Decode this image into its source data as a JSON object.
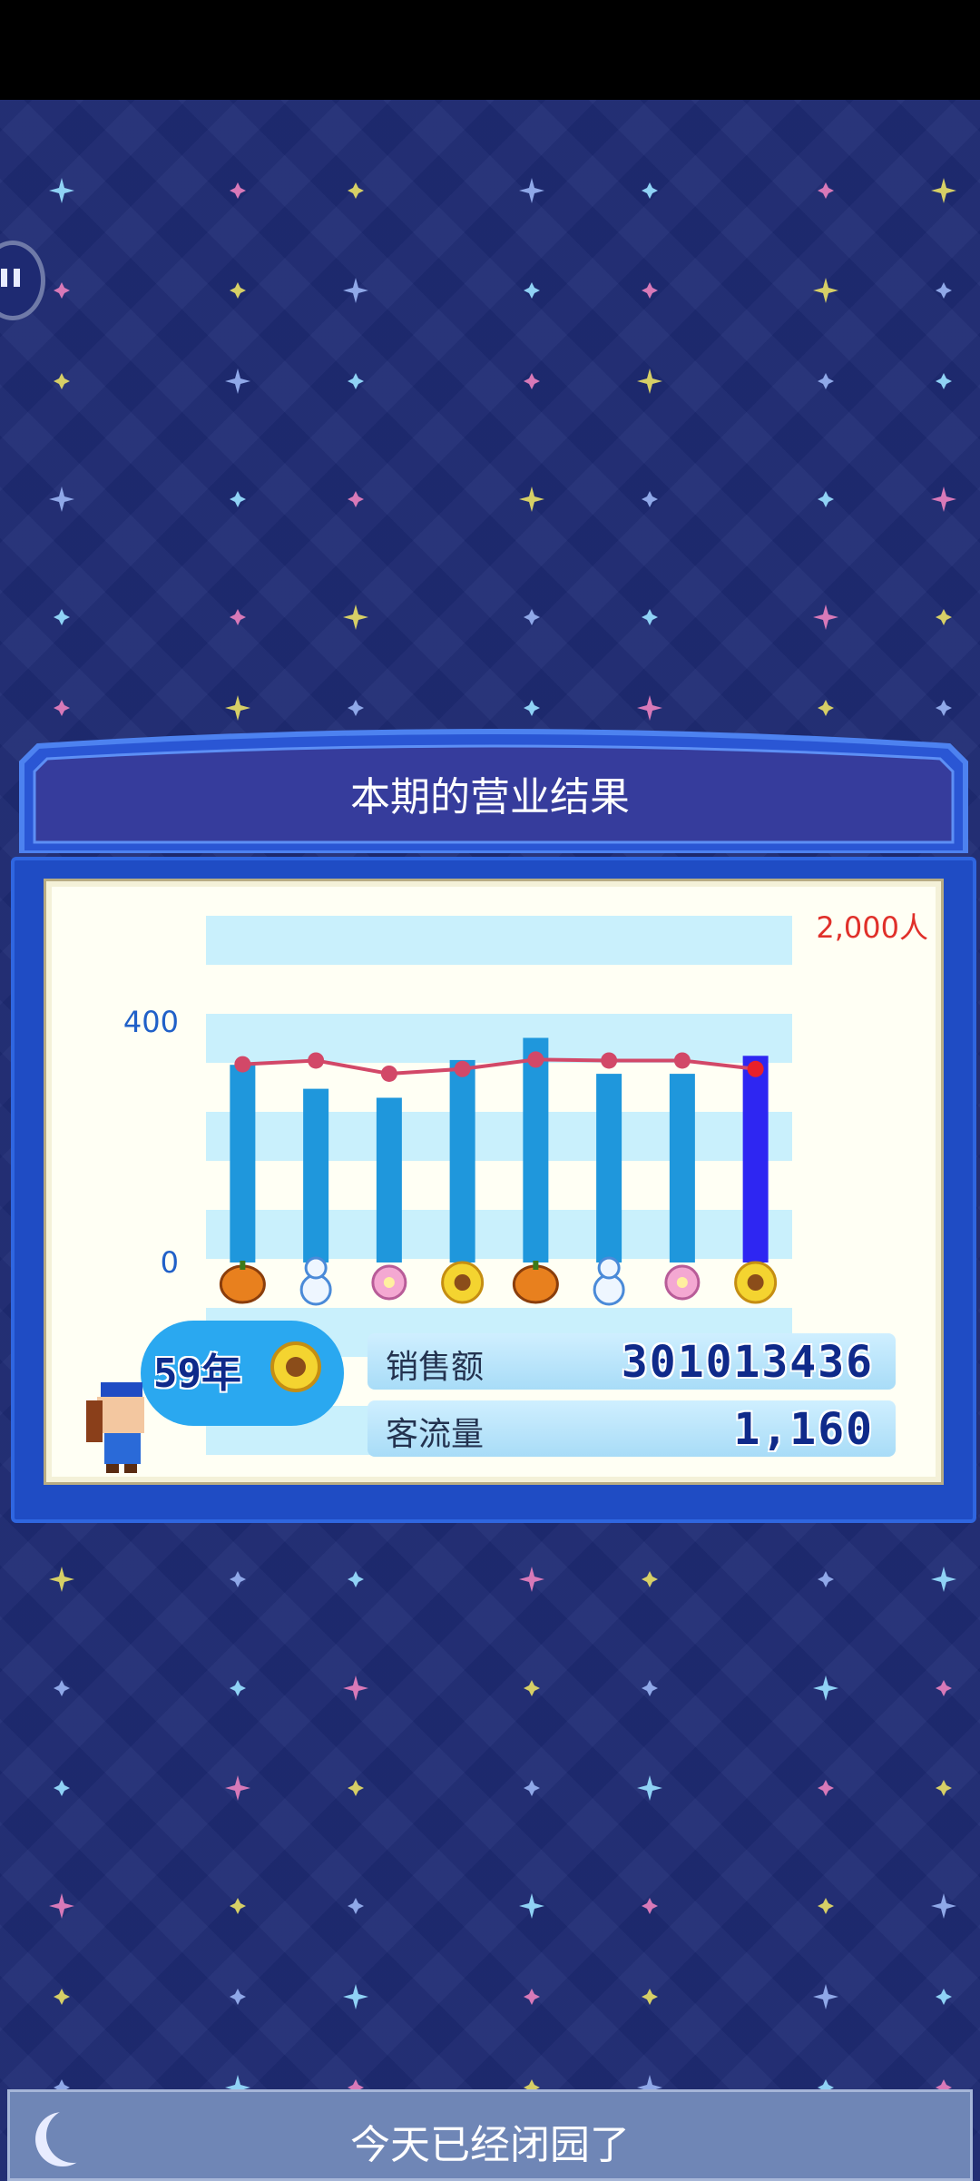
{
  "panel": {
    "title": "本期的营业结果"
  },
  "chart_data": {
    "type": "bar",
    "left_axis_ticks": [
      "400",
      "0"
    ],
    "ylim_left": [
      0,
      400
    ],
    "right_axis_label": "2,000人",
    "season_icons": [
      "pumpkin-icon",
      "snowman-icon",
      "blossom-icon",
      "sunflower-icon",
      "pumpkin-icon",
      "snowman-icon",
      "blossom-icon",
      "sunflower-icon"
    ],
    "bar_values": [
      330,
      290,
      275,
      338,
      375,
      315,
      315,
      345
    ],
    "visitor_line_values": [
      1200,
      1220,
      1150,
      1175,
      1225,
      1220,
      1220,
      1175
    ],
    "visitor_ylim": [
      0,
      2000
    ],
    "highlight_index": 7,
    "colors": {
      "bar": "#1f97dc",
      "bar_current": "#2e26f2",
      "line": "#d24868",
      "grid_band": "#c9f0fc"
    }
  },
  "sales": {
    "label": "销售额",
    "value": "301013436"
  },
  "visitors": {
    "label": "客流量",
    "value": "1,160"
  },
  "year": {
    "value": "59年"
  },
  "bottom_bar": {
    "text": "今天已经闭园了"
  },
  "colors": {
    "background": "#1f2b74",
    "panel_blue": "#1f4cc4",
    "title_bar": "#3a3f9c"
  }
}
